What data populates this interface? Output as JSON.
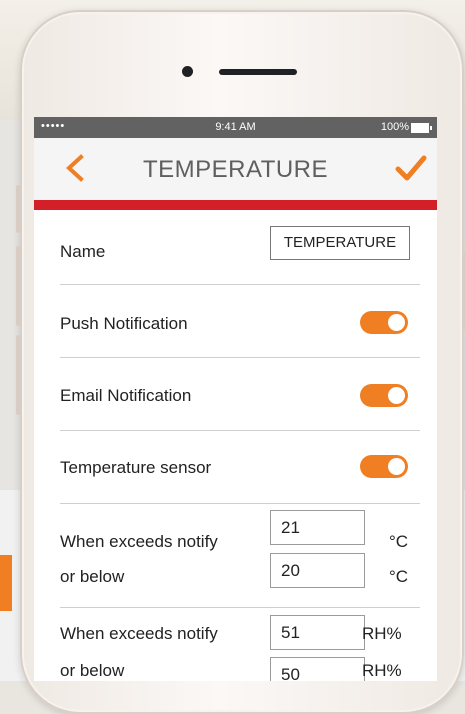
{
  "status_bar": {
    "signal": "•••••",
    "time": "9:41 AM",
    "battery": "100%"
  },
  "header": {
    "title": "TEMPERATURE",
    "back_icon": "chevron-left-icon",
    "confirm_icon": "checkmark-icon"
  },
  "settings": {
    "name_label": "Name",
    "name_value": "TEMPERATURE",
    "push_label": "Push Notification",
    "push_enabled": true,
    "email_label": "Email Notification",
    "email_enabled": true,
    "sensor_label": "Temperature sensor",
    "sensor_enabled": true
  },
  "thresholds": {
    "temp": {
      "exceeds_label": "When exceeds notify",
      "exceeds_value": "21",
      "exceeds_unit": "°C",
      "below_label": "or below",
      "below_value": "20",
      "below_unit": "°C"
    },
    "humidity": {
      "exceeds_label": "When exceeds notify",
      "exceeds_value": "51",
      "exceeds_unit": "RH%",
      "below_label": "or below",
      "below_value": "50",
      "below_unit": "RH%"
    }
  },
  "colors": {
    "accent": "#ef7f22",
    "brand_line": "#d31f27",
    "status_bar": "#626262"
  }
}
